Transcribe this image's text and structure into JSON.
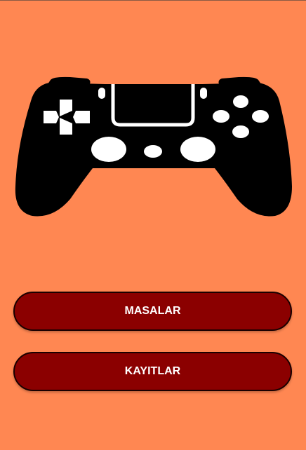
{
  "background_color": "#FF8752",
  "button_color": "#8B0000",
  "logo": {
    "icon": "gamepad-icon"
  },
  "buttons": [
    {
      "label": "MASALAR"
    },
    {
      "label": "KAYITLAR"
    }
  ]
}
